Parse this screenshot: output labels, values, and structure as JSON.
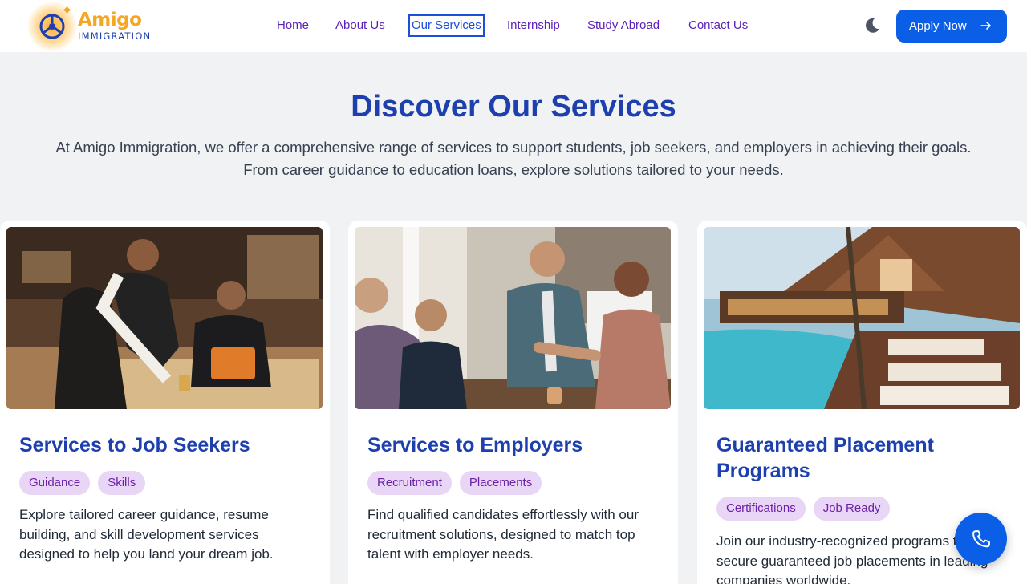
{
  "brand": {
    "name": "Amigo",
    "tagline": "IMMIGRATION"
  },
  "nav": {
    "items": [
      {
        "label": "Home"
      },
      {
        "label": "About Us"
      },
      {
        "label": "Our Services"
      },
      {
        "label": "Internship"
      },
      {
        "label": "Study Abroad"
      },
      {
        "label": "Contact Us"
      }
    ],
    "active": "Our Services"
  },
  "header": {
    "theme_toggle_icon": "moon-icon",
    "apply_label": "Apply Now"
  },
  "hero": {
    "title": "Discover Our Services",
    "description_line1": "At Amigo Immigration, we offer a comprehensive range of services to support students, job seekers, and employers in achieving their goals.",
    "description_line2": "From career guidance to education loans, explore solutions tailored to your needs."
  },
  "cards": [
    {
      "title": "Services to Job Seekers",
      "tags": [
        "Guidance",
        "Skills"
      ],
      "description": "Explore tailored career guidance, resume building, and skill development services designed to help you land your dream job."
    },
    {
      "title": "Services to Employers",
      "tags": [
        "Recruitment",
        "Placements"
      ],
      "description": "Find qualified candidates effortlessly with our recruitment solutions, designed to match top talent with employer needs."
    },
    {
      "title": "Guaranteed Placement Programs",
      "tags": [
        "Certifications",
        "Job Ready"
      ],
      "description": "Join our industry-recognized programs to secure guaranteed job placements in leading companies worldwide."
    }
  ],
  "colors": {
    "primary": "#0b5ee6",
    "heading": "#1e40af",
    "nav": "#5b21b6",
    "tag_bg": "#e9d5f5",
    "logo_orange": "#f5a623"
  },
  "floating": {
    "icon": "phone-icon"
  }
}
